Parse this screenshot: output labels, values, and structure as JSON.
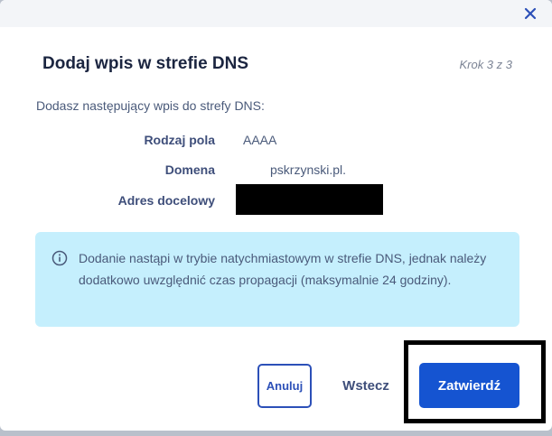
{
  "dialog": {
    "title": "Dodaj wpis w strefie DNS",
    "step": "Krok 3 z 3",
    "intro": "Dodasz następujący wpis do strefy DNS:",
    "fields": {
      "type_label": "Rodzaj pola",
      "type_value": "AAAA",
      "domain_label": "Domena",
      "domain_value": "pskrzynski.pl.",
      "target_label": "Adres docelowy"
    },
    "info": "Dodanie nastąpi w trybie natychmiastowym w strefie DNS, jednak należy dodatkowo uwzględnić czas propagacji (maksymalnie 24 godziny).",
    "buttons": {
      "cancel": "Anuluj",
      "back": "Wstecz",
      "confirm": "Zatwierdź"
    }
  },
  "colors": {
    "accent": "#1554d1",
    "info_background": "#c5effd",
    "title": "#1b2540"
  },
  "icons": {
    "close": "close-icon",
    "info": "info-icon"
  }
}
